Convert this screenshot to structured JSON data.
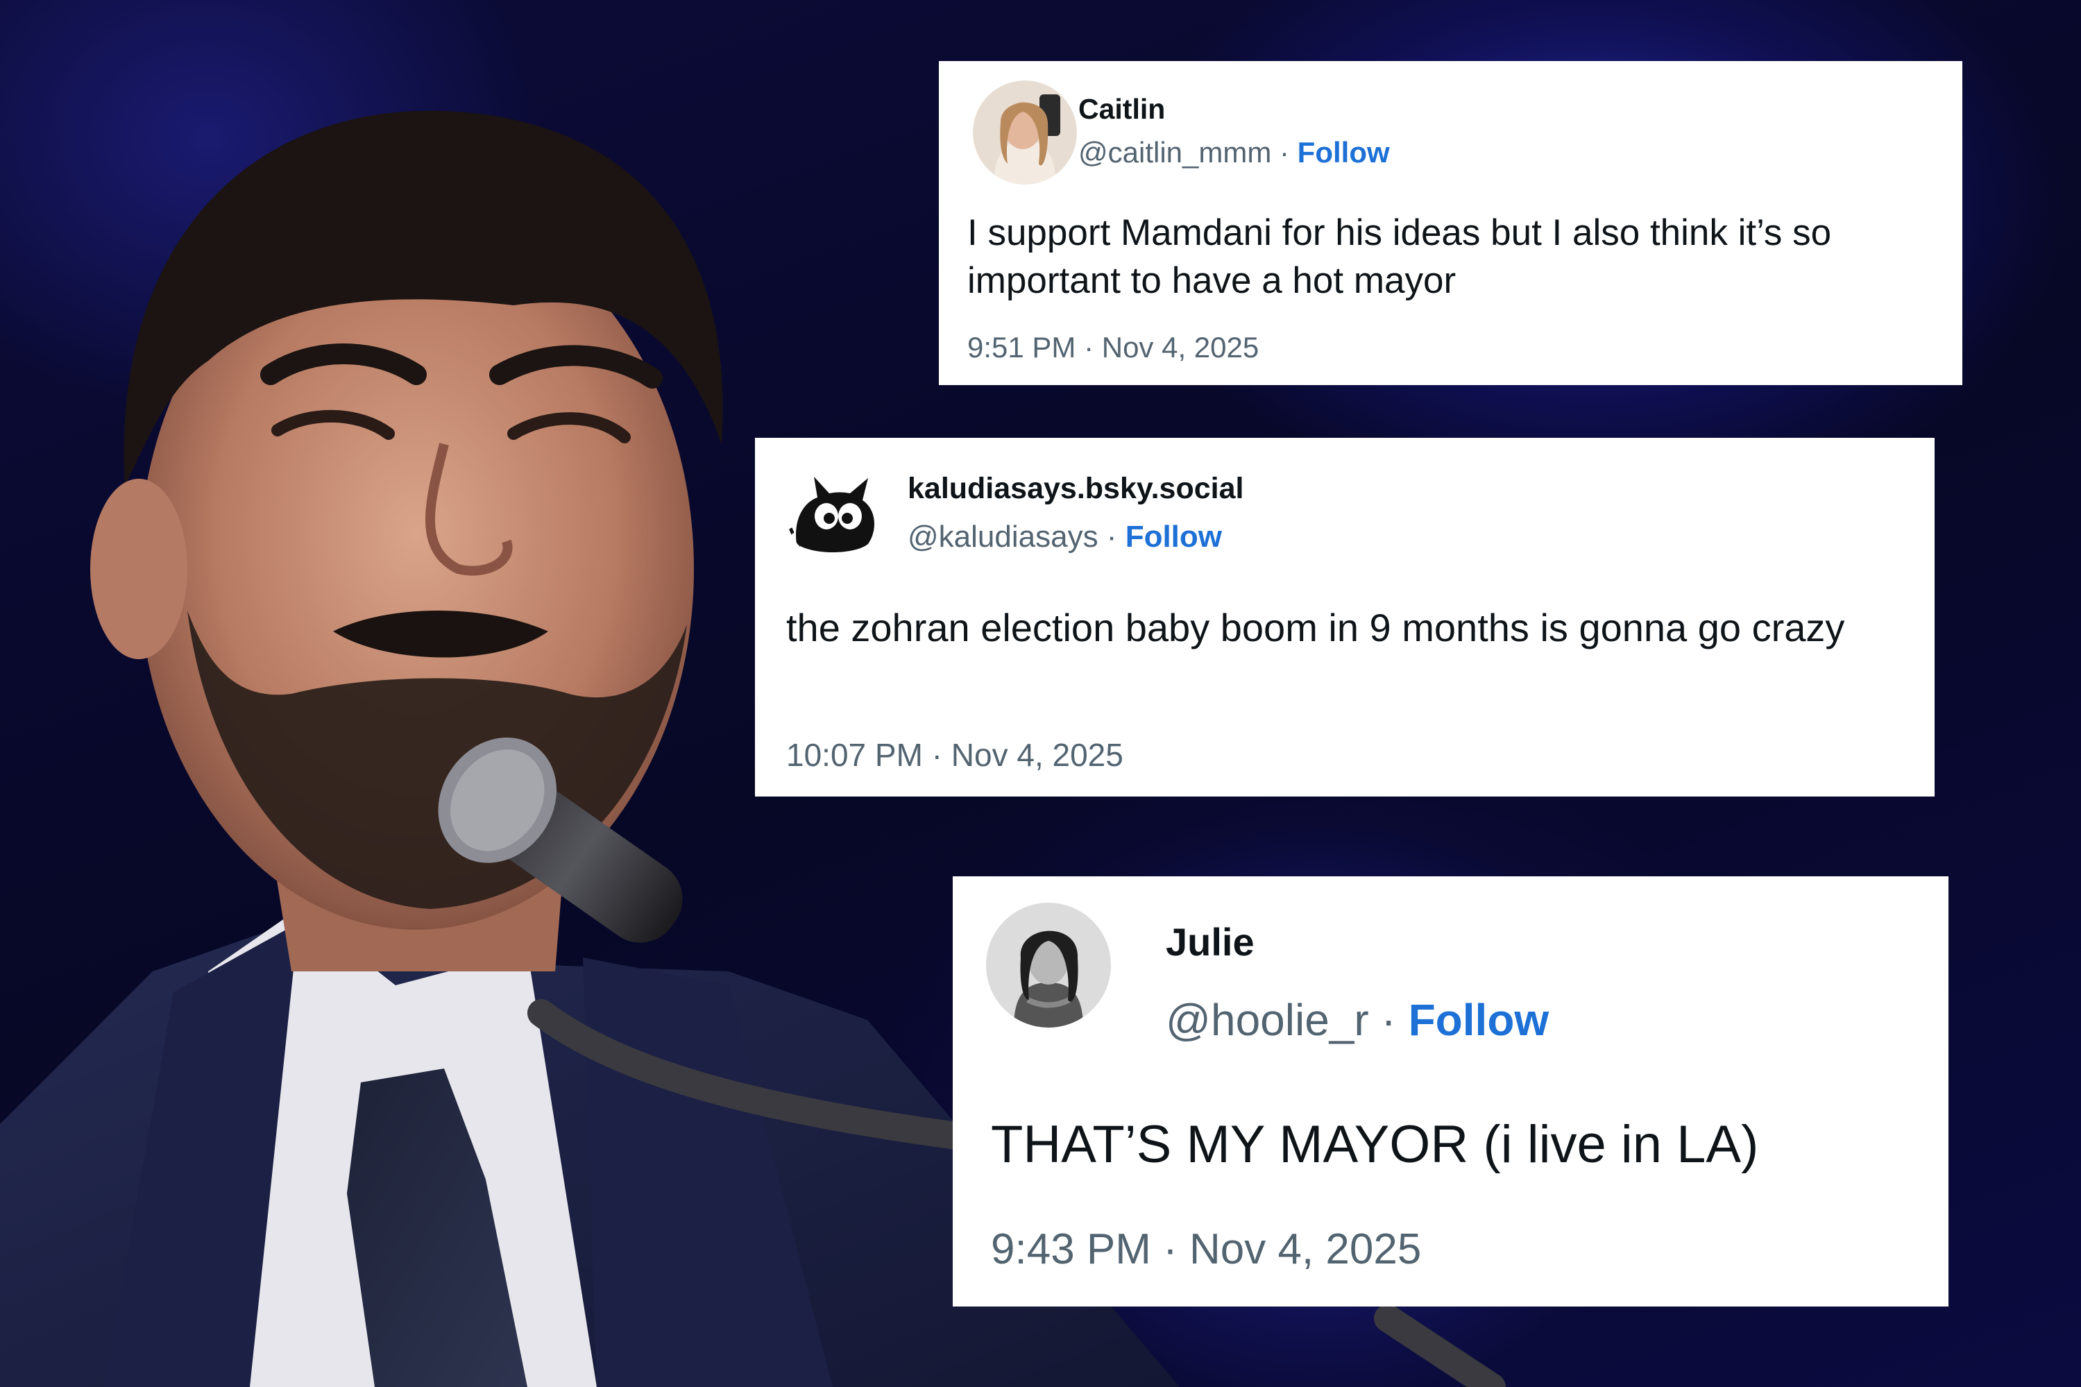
{
  "tweets": [
    {
      "name": "Caitlin",
      "handle": "@caitlin_mmm",
      "separator": " · ",
      "follow_label": "Follow",
      "text": "I support Mamdani for his ideas but I also think it’s so important to have a hot mayor",
      "timestamp": "9:51 PM · Nov 4, 2025",
      "avatar_icon": "woman-selfie-avatar-icon"
    },
    {
      "name": "kaludiasays.bsky.social",
      "handle": "@kaludiasays",
      "separator": " · ",
      "follow_label": "Follow",
      "text": "the zohran election baby boom in 9 months is gonna go crazy",
      "timestamp": "10:07 PM · Nov 4, 2025",
      "avatar_icon": "black-cat-avatar-icon"
    },
    {
      "name": "Julie",
      "handle": "@hoolie_r",
      "separator": " · ",
      "follow_label": "Follow",
      "text": "THAT’S MY MAYOR (i live in LA)",
      "timestamp": "9:43 PM · Nov 4, 2025",
      "avatar_icon": "woman-portrait-avatar-icon"
    }
  ],
  "colors": {
    "follow_link": "#1d70d6",
    "muted_text": "#536471",
    "background": "#0a0a2e"
  }
}
